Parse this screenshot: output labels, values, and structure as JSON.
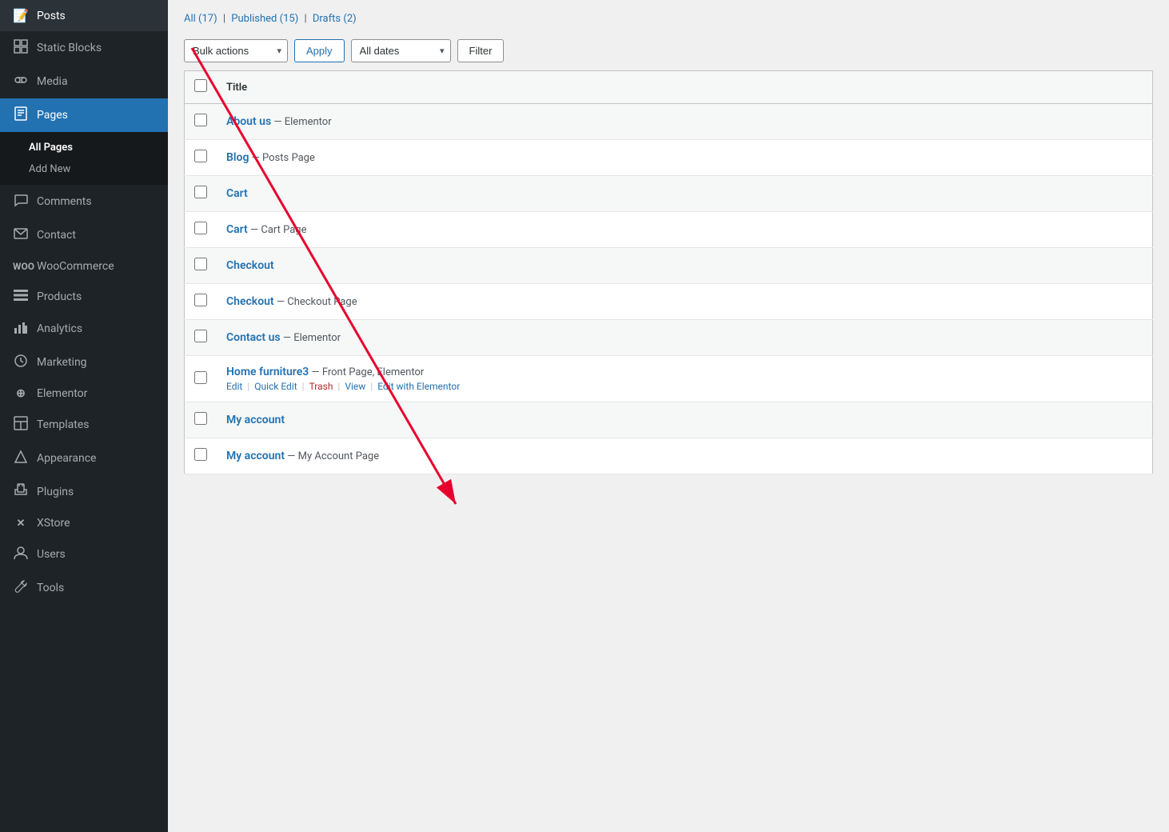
{
  "sidebar": {
    "items": [
      {
        "id": "posts",
        "label": "Posts",
        "icon": "📝",
        "active": false
      },
      {
        "id": "static-blocks",
        "label": "Static Blocks",
        "icon": "▦",
        "active": false
      },
      {
        "id": "media",
        "label": "Media",
        "icon": "🎵",
        "active": false
      },
      {
        "id": "pages",
        "label": "Pages",
        "icon": "📄",
        "active": true
      },
      {
        "id": "comments",
        "label": "Comments",
        "icon": "💬",
        "active": false
      },
      {
        "id": "contact",
        "label": "Contact",
        "icon": "✉",
        "active": false
      },
      {
        "id": "woocommerce",
        "label": "WooCommerce",
        "icon": "W",
        "active": false
      },
      {
        "id": "products",
        "label": "Products",
        "icon": "☰",
        "active": false
      },
      {
        "id": "analytics",
        "label": "Analytics",
        "icon": "📊",
        "active": false
      },
      {
        "id": "marketing",
        "label": "Marketing",
        "icon": "📣",
        "active": false
      },
      {
        "id": "elementor",
        "label": "Elementor",
        "icon": "⊕",
        "active": false
      },
      {
        "id": "templates",
        "label": "Templates",
        "icon": "🗂",
        "active": false
      },
      {
        "id": "appearance",
        "label": "Appearance",
        "icon": "🎨",
        "active": false
      },
      {
        "id": "plugins",
        "label": "Plugins",
        "icon": "🔌",
        "active": false
      },
      {
        "id": "xstore",
        "label": "XStore",
        "icon": "✕",
        "active": false
      },
      {
        "id": "users",
        "label": "Users",
        "icon": "👤",
        "active": false
      },
      {
        "id": "tools",
        "label": "Tools",
        "icon": "🔧",
        "active": false
      }
    ],
    "submenu": {
      "parent": "pages",
      "items": [
        {
          "id": "all-pages",
          "label": "All Pages",
          "active": true
        },
        {
          "id": "add-new",
          "label": "Add New",
          "active": false
        }
      ]
    }
  },
  "header": {
    "stats": {
      "all_label": "All",
      "all_count": "17",
      "published_label": "Published",
      "published_count": "15",
      "drafts_label": "Drafts",
      "drafts_count": "2"
    },
    "toolbar": {
      "bulk_actions_label": "Bulk actions",
      "apply_label": "Apply",
      "all_dates_label": "All dates",
      "filter_label": "Filter"
    }
  },
  "table": {
    "header": {
      "title_label": "Title"
    },
    "rows": [
      {
        "id": "about-us",
        "title": "About us",
        "suffix": " — Elementor",
        "actions": [],
        "highlighted": false
      },
      {
        "id": "blog",
        "title": "Blog",
        "suffix": " — Posts Page",
        "actions": [],
        "highlighted": false
      },
      {
        "id": "cart",
        "title": "Cart",
        "suffix": "",
        "actions": [],
        "highlighted": false
      },
      {
        "id": "cart-page",
        "title": "Cart",
        "suffix": " — Cart Page",
        "actions": [],
        "highlighted": false
      },
      {
        "id": "checkout",
        "title": "Checkout",
        "suffix": "",
        "actions": [],
        "highlighted": false
      },
      {
        "id": "checkout-page",
        "title": "Checkout",
        "suffix": " — Checkout Page",
        "actions": [],
        "highlighted": false
      },
      {
        "id": "contact-us",
        "title": "Contact us",
        "suffix": " — Elementor",
        "actions": [],
        "highlighted": false
      },
      {
        "id": "home-furniture3",
        "title": "Home furniture3",
        "suffix": " — Front Page, Elementor",
        "actions": [
          {
            "id": "edit",
            "label": "Edit"
          },
          {
            "id": "quick-edit",
            "label": "Quick Edit"
          },
          {
            "id": "trash",
            "label": "Trash",
            "class": "trash"
          },
          {
            "id": "view",
            "label": "View"
          },
          {
            "id": "edit-elementor",
            "label": "Edit with Elementor"
          }
        ],
        "highlighted": true
      },
      {
        "id": "my-account",
        "title": "My account",
        "suffix": "",
        "actions": [],
        "highlighted": false
      },
      {
        "id": "my-account-page",
        "title": "My account",
        "suffix": " — My Account Page",
        "actions": [],
        "highlighted": false
      }
    ]
  },
  "colors": {
    "link": "#2271b1",
    "sidebar_active": "#2271b1",
    "sidebar_bg": "#1d2327",
    "arrow_color": "#e8002d"
  }
}
